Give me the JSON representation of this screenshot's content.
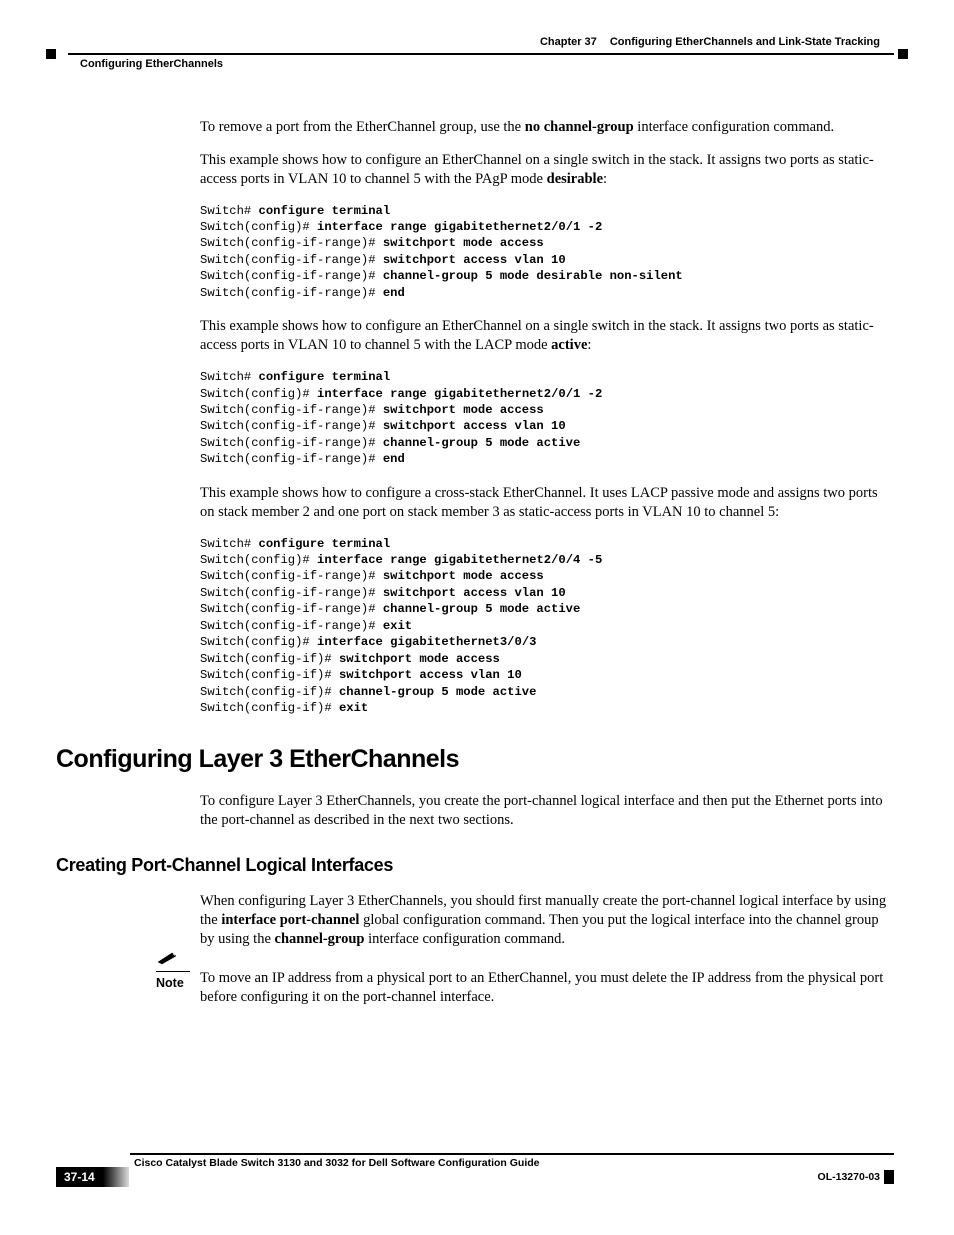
{
  "header": {
    "chapter_num": "Chapter 37",
    "chapter_title": "Configuring EtherChannels and Link-State Tracking",
    "section_running": "Configuring EtherChannels"
  },
  "paragraphs": {
    "p1_a": "To remove a port from the EtherChannel group, use the ",
    "p1_b": "no channel-group",
    "p1_c": " interface configuration command.",
    "p2_a": "This example shows how to configure an EtherChannel on a single switch in the stack. It assigns two ports as static-access ports in VLAN 10 to channel 5 with the PAgP mode ",
    "p2_b": "desirable",
    "p2_c": ":",
    "p3_a": "This example shows how to configure an EtherChannel on a single switch in the stack. It assigns two ports as static-access ports in VLAN 10 to channel 5 with the LACP mode ",
    "p3_b": "active",
    "p3_c": ":",
    "p4": "This example shows how to configure a cross-stack EtherChannel. It uses LACP passive mode and assigns two ports on stack member 2 and one port on stack member 3 as static-access ports in VLAN 10 to channel 5:",
    "p5": "To configure Layer 3 EtherChannels, you create the port-channel logical interface and then put the Ethernet ports into the port-channel as described in the next two sections.",
    "p6_a": "When configuring Layer 3 EtherChannels, you should first manually create the port-channel logical interface by using the ",
    "p6_b": "interface port-channel",
    "p6_c": " global configuration command. Then you put the logical interface into the channel group by using the ",
    "p6_d": "channel-group",
    "p6_e": " interface configuration command."
  },
  "code1": {
    "l1p": "Switch# ",
    "l1c": "configure terminal",
    "l2p": "Switch(config)# ",
    "l2c": "interface range gigabitethernet2/0/1 -2",
    "l3p": "Switch(config-if-range)# ",
    "l3c": "switchport mode access",
    "l4p": "Switch(config-if-range)# ",
    "l4c": "switchport access vlan 10",
    "l5p": "Switch(config-if-range)# ",
    "l5c": "channel-group 5 mode desirable non-silent",
    "l6p": "Switch(config-if-range)# ",
    "l6c": "end"
  },
  "code2": {
    "l1p": "Switch# ",
    "l1c": "configure terminal",
    "l2p": "Switch(config)# ",
    "l2c": "interface range gigabitethernet2/0/1 -2",
    "l3p": "Switch(config-if-range)# ",
    "l3c": "switchport mode access",
    "l4p": "Switch(config-if-range)# ",
    "l4c": "switchport access vlan 10",
    "l5p": "Switch(config-if-range)# ",
    "l5c": "channel-group 5 mode active",
    "l6p": "Switch(config-if-range)# ",
    "l6c": "end"
  },
  "code3": {
    "l1p": "Switch# ",
    "l1c": "configure terminal",
    "l2p": "Switch(config)# ",
    "l2c": "interface range gigabitethernet2/0/4 -5",
    "l3p": "Switch(config-if-range)# ",
    "l3c": "switchport mode access",
    "l4p": "Switch(config-if-range)# ",
    "l4c": "switchport access vlan 10",
    "l5p": "Switch(config-if-range)# ",
    "l5c": "channel-group 5 mode active",
    "l6p": "Switch(config-if-range)# ",
    "l6c": "exit",
    "l7p": "Switch(config)# ",
    "l7c": "interface gigabitethernet3/0/3",
    "l8p": "Switch(config-if)# ",
    "l8c": "switchport mode access",
    "l9p": "Switch(config-if)# ",
    "l9c": "switchport access vlan 10",
    "l10p": "Switch(config-if)# ",
    "l10c": "channel-group 5 mode active",
    "l11p": "Switch(config-if)# ",
    "l11c": "exit"
  },
  "headings": {
    "h1": "Configuring Layer 3 EtherChannels",
    "h2": "Creating Port-Channel Logical Interfaces"
  },
  "note": {
    "label": "Note",
    "text": "To move an IP address from a physical port to an EtherChannel, you must delete the IP address from the physical port before configuring it on the port-channel interface."
  },
  "footer": {
    "book_title": "Cisco Catalyst Blade Switch 3130 and 3032 for Dell Software Configuration Guide",
    "page_num": "37-14",
    "doc_num": "OL-13270-03"
  }
}
